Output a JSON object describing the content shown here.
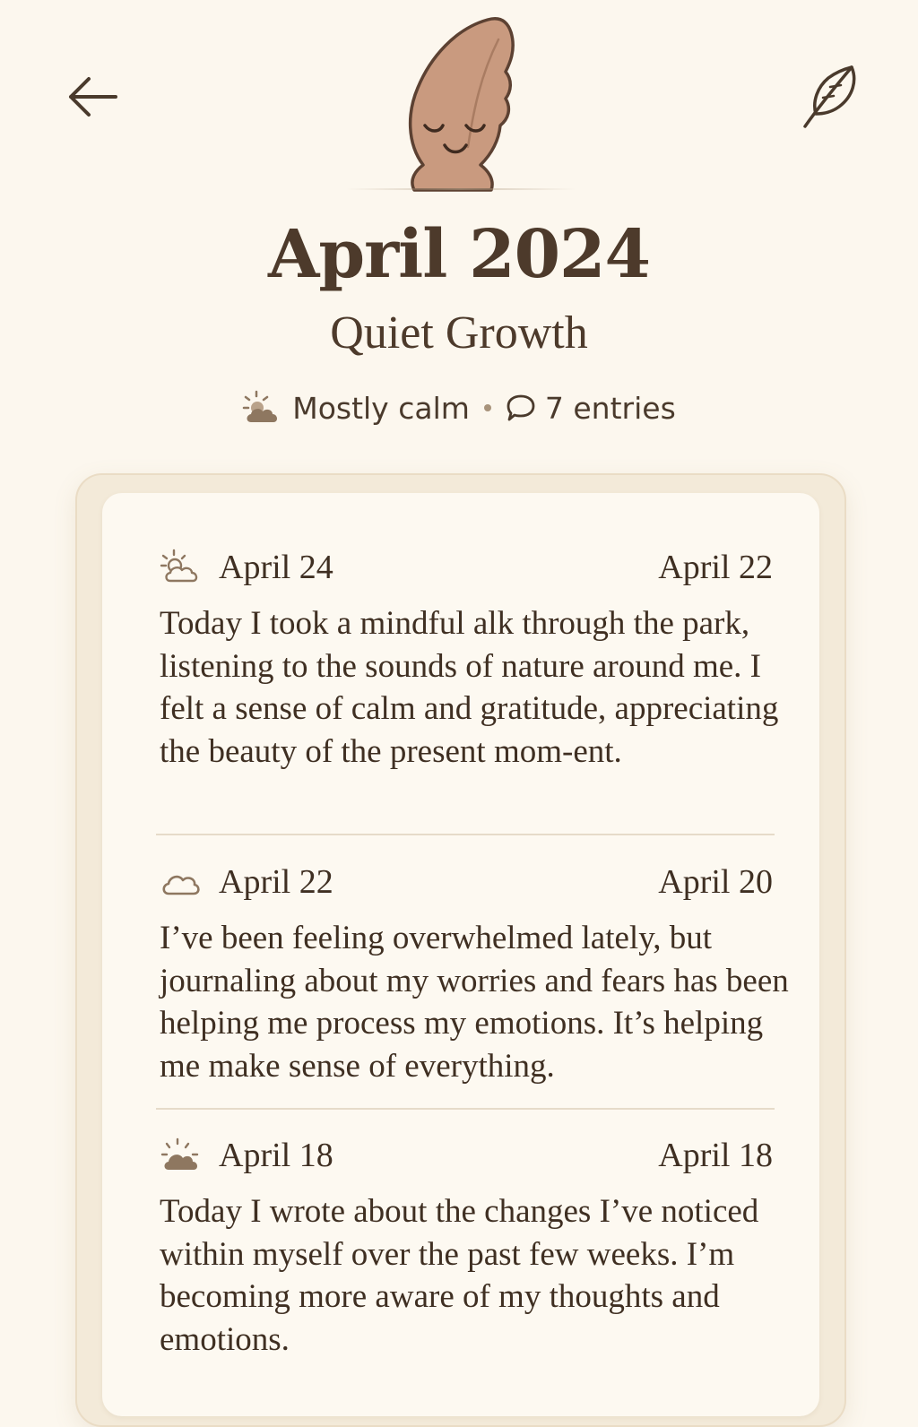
{
  "header": {
    "back_icon": "arrow-left-icon",
    "write_icon": "feather-quill-icon",
    "mascot_icon": "sleeping-seed-mascot"
  },
  "title": "April 2024",
  "subtitle": "Quiet Growth",
  "stats": {
    "mood_icon": "sun-behind-cloud-icon",
    "mood": "Mostly calm",
    "entries_icon": "speech-bubble-icon",
    "entries": "7 entries"
  },
  "entries": [
    {
      "icon": "sun-behind-cloud-icon",
      "date": "April 24",
      "date_right": "April 22",
      "text": "Today I took a mindful alk through the park, listening to the sounds of nature around me. I felt a sense of calm and gratitude, appreciating the beauty of the present mom-ent."
    },
    {
      "icon": "cloud-icon",
      "date": "April 22",
      "date_right": "April 20",
      "text": "I’ve been feeling overwhelmed lately, but journaling about my worries and fears has been helping me process my emotions. It’s helping me make sense of everything."
    },
    {
      "icon": "sunrise-cloud-icon",
      "date": "April 18",
      "date_right": "April 18",
      "text": "Today I wrote about the changes I’ve noticed within myself over the past few weeks. I’m becoming more aware of my thoughts and emotions."
    }
  ],
  "colors": {
    "background": "#fcf7ee",
    "text": "#4a3a2c",
    "mascot": "#c99a7f",
    "card": "#fdf9f1"
  }
}
